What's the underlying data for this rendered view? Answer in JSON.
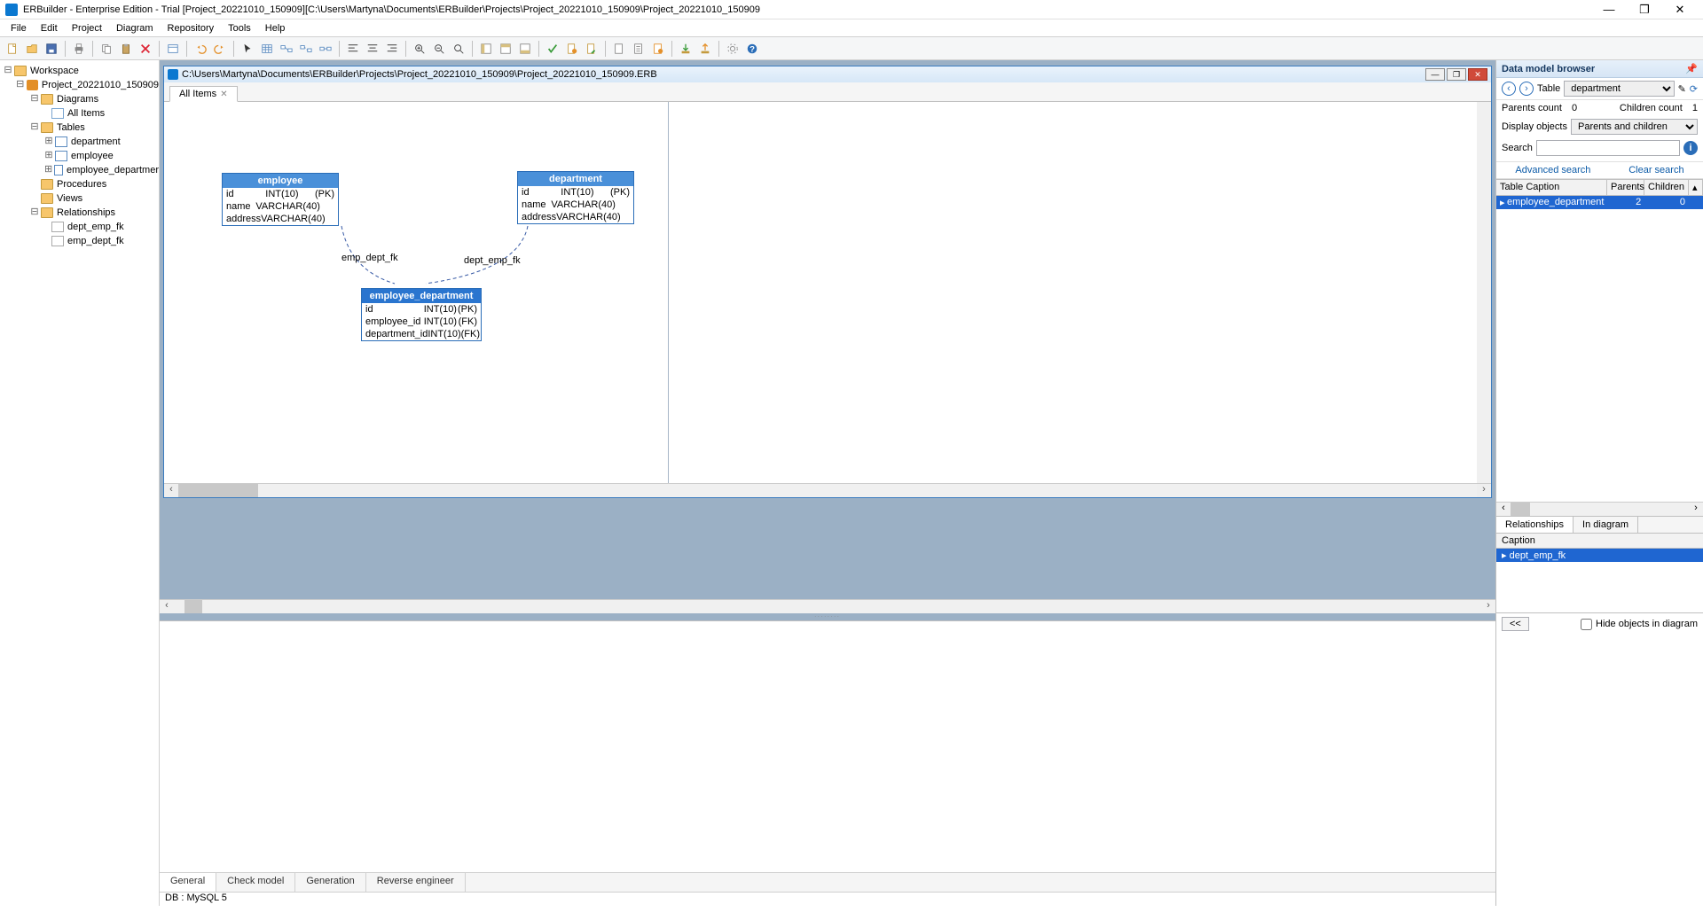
{
  "window": {
    "title": "ERBuilder - Enterprise Edition  - Trial [Project_20221010_150909][C:\\Users\\Martyna\\Documents\\ERBuilder\\Projects\\Project_20221010_150909\\Project_20221010_150909"
  },
  "menu": [
    "File",
    "Edit",
    "Project",
    "Diagram",
    "Repository",
    "Tools",
    "Help"
  ],
  "tree": {
    "root": "Workspace",
    "project": "Project_20221010_150909",
    "diagrams": "Diagrams",
    "all_items": "All Items",
    "tables": "Tables",
    "table_items": [
      "department",
      "employee",
      "employee_departmer"
    ],
    "procedures": "Procedures",
    "views": "Views",
    "relationships": "Relationships",
    "rel_items": [
      "dept_emp_fk",
      "emp_dept_fk"
    ]
  },
  "doc": {
    "path": "C:\\Users\\Martyna\\Documents\\ERBuilder\\Projects\\Project_20221010_150909\\Project_20221010_150909.ERB",
    "tab": "All Items"
  },
  "entities": {
    "employee": {
      "title": "employee",
      "cols": [
        {
          "name": "id",
          "type": "INT(10)",
          "key": "(PK)"
        },
        {
          "name": "name",
          "type": "VARCHAR(40)",
          "key": ""
        },
        {
          "name": "address",
          "type": "VARCHAR(40)",
          "key": ""
        }
      ]
    },
    "department": {
      "title": "department",
      "cols": [
        {
          "name": "id",
          "type": "INT(10)",
          "key": "(PK)"
        },
        {
          "name": "name",
          "type": "VARCHAR(40)",
          "key": ""
        },
        {
          "name": "address",
          "type": "VARCHAR(40)",
          "key": ""
        }
      ]
    },
    "employee_department": {
      "title": "employee_department",
      "cols": [
        {
          "name": "id",
          "type": "INT(10)",
          "key": "(PK)"
        },
        {
          "name": "employee_id",
          "type": "INT(10)",
          "key": "(FK)"
        },
        {
          "name": "department_id",
          "type": "INT(10)",
          "key": "(FK)"
        }
      ]
    }
  },
  "fk_labels": {
    "emp_dept": "emp_dept_fk",
    "dept_emp": "dept_emp_fk"
  },
  "bottom_tabs": [
    "General",
    "Check model",
    "Generation",
    "Reverse engineer"
  ],
  "status": "DB : MySQL 5",
  "browser": {
    "title": "Data model browser",
    "table_label": "Table",
    "table_value": "department",
    "parents_label": "Parents count",
    "parents_value": "0",
    "children_label": "Children count",
    "children_value": "1",
    "display_label": "Display objects",
    "display_value": "Parents and children",
    "search_label": "Search",
    "adv_search": "Advanced search",
    "clear_search": "Clear search",
    "grid_headers": {
      "caption": "Table Caption",
      "parents": "Parents",
      "children": "Children"
    },
    "grid_row": {
      "caption": "employee_department",
      "parents": "2",
      "children": "0"
    },
    "rel_tabs": [
      "Relationships",
      "In diagram"
    ],
    "rel_caption_header": "Caption",
    "rel_row": "dept_emp_fk",
    "nav_prev": "<<",
    "hide_label": "Hide objects in diagram"
  }
}
